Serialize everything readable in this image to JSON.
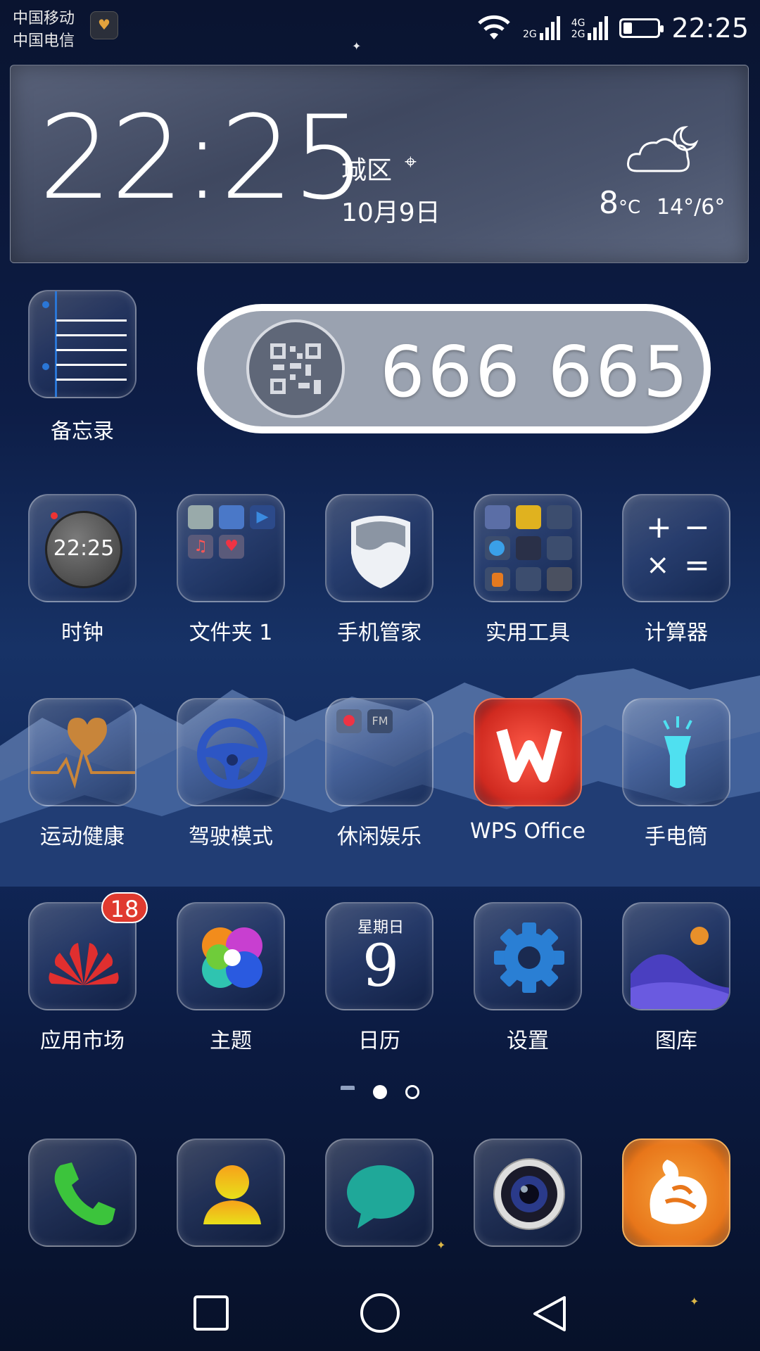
{
  "status_bar": {
    "carrier_1": "中国移动",
    "carrier_2": "中国电信",
    "net_1_top": "2G",
    "net_2_top": "4G",
    "net_2_bottom": "2G",
    "time": "22:25",
    "battery_level": 0.25
  },
  "widget": {
    "time": "22:25",
    "location": "城区",
    "date": "10月9日",
    "temperature": "8",
    "temp_unit": "°C",
    "temp_range": "14°/6°",
    "weather_icon": "cloud-moon-icon"
  },
  "memo": {
    "label": "备忘录"
  },
  "qr_widget": {
    "number": "666 665"
  },
  "apps_row1": [
    {
      "label": "时钟",
      "clock_face": "22:25"
    },
    {
      "label": "文件夹 1"
    },
    {
      "label": "手机管家"
    },
    {
      "label": "实用工具"
    },
    {
      "label": "计算器"
    }
  ],
  "apps_row2": [
    {
      "label": "运动健康"
    },
    {
      "label": "驾驶模式"
    },
    {
      "label": "休闲娱乐"
    },
    {
      "label": "WPS Office"
    },
    {
      "label": "手电筒"
    }
  ],
  "apps_row3": [
    {
      "label": "应用市场",
      "badge": "18"
    },
    {
      "label": "主题"
    },
    {
      "label": "日历",
      "weekday": "星期日",
      "day": "9"
    },
    {
      "label": "设置"
    },
    {
      "label": "图库"
    }
  ],
  "dock": [
    {
      "icon": "phone-icon"
    },
    {
      "icon": "contacts-icon"
    },
    {
      "icon": "messages-icon"
    },
    {
      "icon": "camera-icon"
    },
    {
      "icon": "uc-browser-icon"
    }
  ],
  "page_indicator": {
    "pages": 3,
    "current": 1
  },
  "nav_bar": {
    "buttons": [
      "recent-apps",
      "home",
      "back"
    ]
  },
  "colors": {
    "badge_red": "#e03a2f",
    "calc_blue": "#1b2c5a",
    "wps_red": "#e2322a",
    "phone_green": "#3cc43c",
    "uc_orange": "#f08a1c"
  }
}
